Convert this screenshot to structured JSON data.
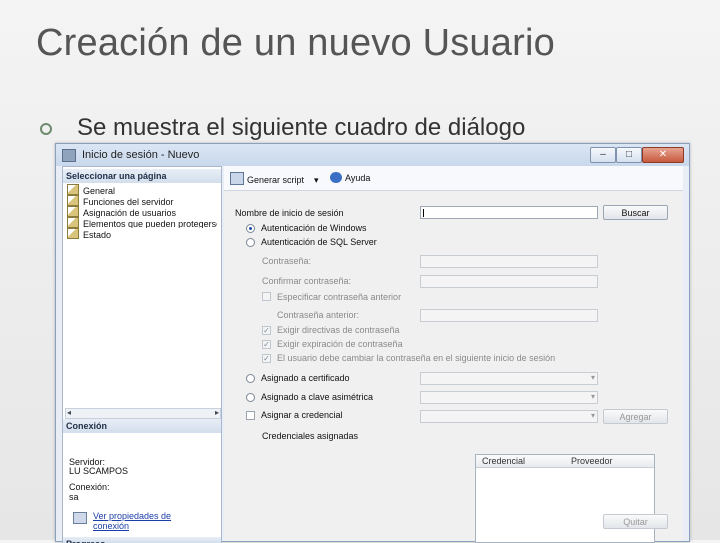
{
  "slide": {
    "title": "Creación de un nuevo Usuario",
    "bullet": "Se muestra el siguiente cuadro de diálogo"
  },
  "window": {
    "title": "Inicio de sesión - Nuevo",
    "controls": {
      "minimize": "–",
      "maximize": "□",
      "close": "✕"
    }
  },
  "left_pane": {
    "select_page_header": "Seleccionar una página",
    "pages": [
      "General",
      "Funciones del servidor",
      "Asignación de usuarios",
      "Elementos que pueden protegerse",
      "Estado"
    ],
    "connection_header": "Conexión",
    "server_label": "Servidor:",
    "server_value": "LU SCAMPOS",
    "connection_label": "Conexión:",
    "connection_value": "sa",
    "view_properties_line1": "Ver propiedades de",
    "view_properties_line2": "conexión",
    "progress_header": "Progreso"
  },
  "toolbar": {
    "script_label": "Generar script",
    "help_label": "Ayuda"
  },
  "form": {
    "login_name_label": "Nombre de inicio de sesión",
    "login_name_value": "",
    "search_button": "Buscar",
    "windows_auth": "Autenticación de Windows",
    "sql_auth": "Autenticación de SQL Server",
    "password_label": "Contraseña:",
    "confirm_password_label": "Confirmar contraseña:",
    "specify_old_password": "Especificar contraseña anterior",
    "old_password_label": "Contraseña anterior:",
    "enforce_policy": "Exigir directivas de contraseña",
    "enforce_expiration": "Exigir expiración de contraseña",
    "must_change": "El usuario debe cambiar la contraseña en el siguiente inicio de sesión",
    "mapped_certificate": "Asignado a certificado",
    "mapped_asymmetric_key": "Asignado a clave asimétrica",
    "map_to_credential": "Asignar a credencial",
    "add_button": "Agregar",
    "mapped_credentials_label": "Credenciales asignadas",
    "credentials_columns": [
      "Credencial",
      "Proveedor"
    ],
    "remove_button": "Quitar"
  },
  "colors": {
    "link": "#1b3fa8",
    "window_border": "#8aa0bf",
    "close_button": "#c75a3e"
  },
  "icons": {
    "toolbar_script": "script-icon",
    "toolbar_help": "help-icon",
    "page": "page-icon",
    "link": "connection-properties-icon"
  }
}
